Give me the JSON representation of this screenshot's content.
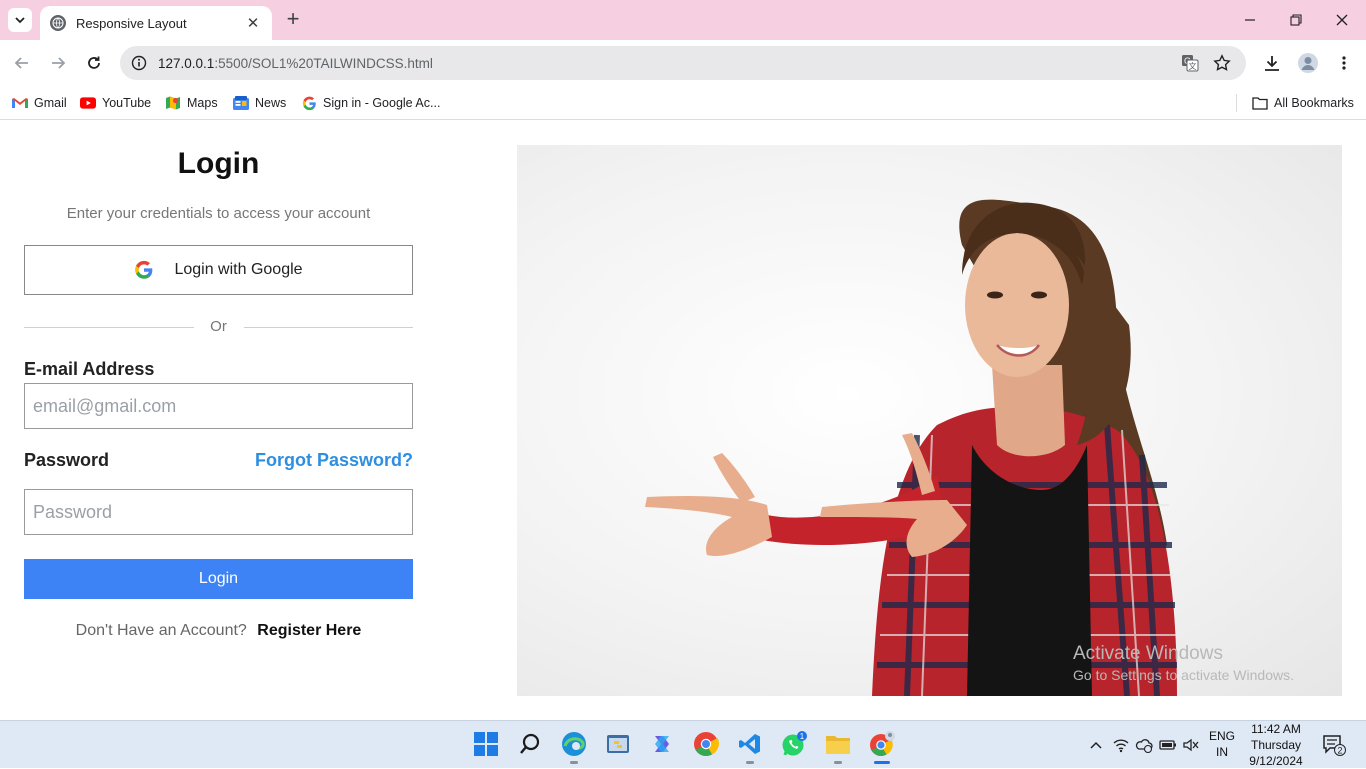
{
  "browser": {
    "tab_title": "Responsive Layout",
    "url_host": "127.0.0.1",
    "url_rest": ":5500/SOL1%20TAILWINDCSS.html",
    "bookmarks": [
      {
        "label": "Gmail",
        "icon": "gmail-icon"
      },
      {
        "label": "YouTube",
        "icon": "youtube-icon"
      },
      {
        "label": "Maps",
        "icon": "maps-icon"
      },
      {
        "label": "News",
        "icon": "news-icon"
      },
      {
        "label": "Sign in - Google Ac...",
        "icon": "google-icon"
      }
    ],
    "all_bookmarks": "All Bookmarks"
  },
  "login": {
    "title": "Login",
    "subtitle": "Enter your credentials to access your account",
    "google_button": "Login with Google",
    "divider": "Or",
    "email_label": "E-mail Address",
    "email_placeholder": "email@gmail.com",
    "password_label": "Password",
    "forgot_link": "Forgot Password?",
    "password_placeholder": "Password",
    "submit": "Login",
    "no_account": "Don't Have an Account?",
    "register_link": "Register Here"
  },
  "watermark": {
    "line1": "Activate Windows",
    "line2": "Go to Settings to activate Windows."
  },
  "taskbar": {
    "whatsapp_badge": "1",
    "lang_top": "ENG",
    "lang_bottom": "IN",
    "time": "11:42 AM",
    "day": "Thursday",
    "date": "9/12/2024",
    "notification_count": "2"
  },
  "colors": {
    "tabbar": "#f6cfe0",
    "primary_button": "#3d83f6",
    "link": "#2e8fe0"
  }
}
